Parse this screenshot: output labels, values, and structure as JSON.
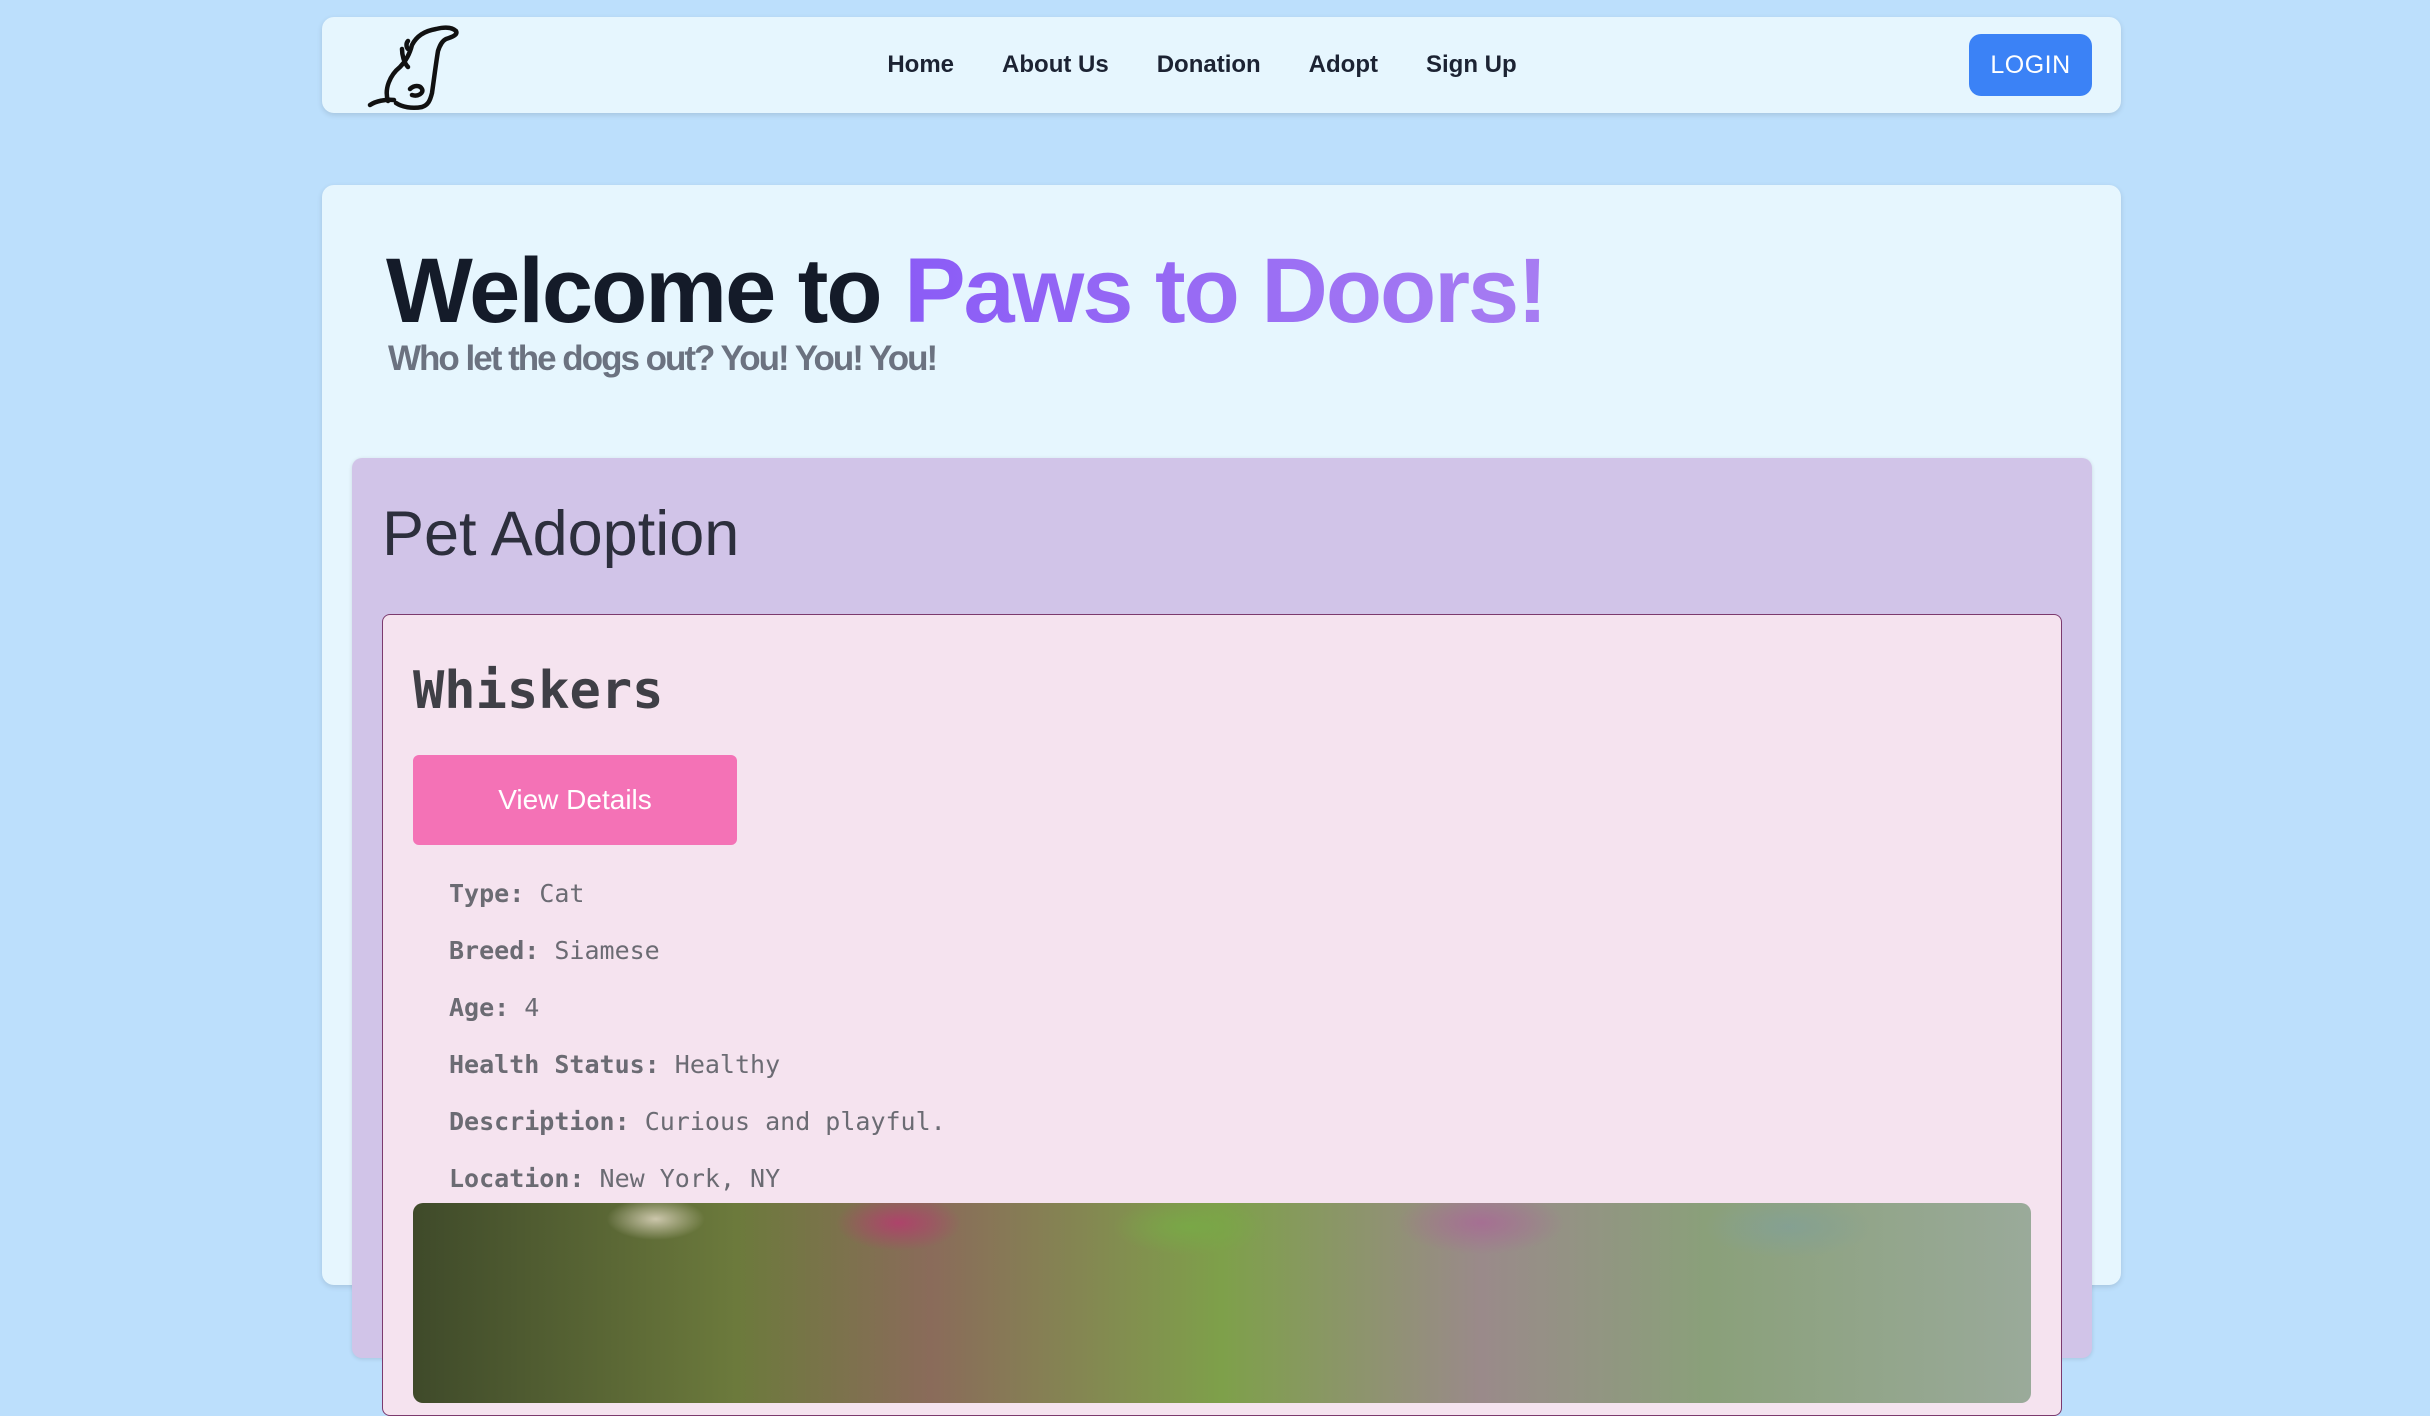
{
  "nav": {
    "links": [
      "Home",
      "About Us",
      "Donation",
      "Adopt",
      "Sign Up"
    ],
    "login_label": "LOGIN"
  },
  "hero": {
    "title_prefix": "Welcome to ",
    "title_brand": "Paws to Doors!",
    "subtitle": "Who let the dogs out? You! You! You!"
  },
  "adoption": {
    "title": "Pet Adoption",
    "pet": {
      "name": "Whiskers",
      "view_details_label": "View Details",
      "details": [
        {
          "label": "Type:",
          "value": "Cat"
        },
        {
          "label": "Breed:",
          "value": "Siamese"
        },
        {
          "label": "Age:",
          "value": "4"
        },
        {
          "label": "Health Status:",
          "value": "Healthy"
        },
        {
          "label": "Description:",
          "value": "Curious and playful."
        },
        {
          "label": "Location:",
          "value": "New York, NY"
        }
      ]
    }
  },
  "colors": {
    "page_bg": "#bcdffc",
    "panel_bg": "#e6f6fe",
    "accent_blue": "#3b82f6",
    "brand_purple": "#8b5cf6",
    "section_bg": "#d1c4e8",
    "card_bg": "#f5e3ef",
    "button_pink": "#f472b6"
  },
  "icons": {
    "logo": "dog-sitting-logo-icon"
  }
}
